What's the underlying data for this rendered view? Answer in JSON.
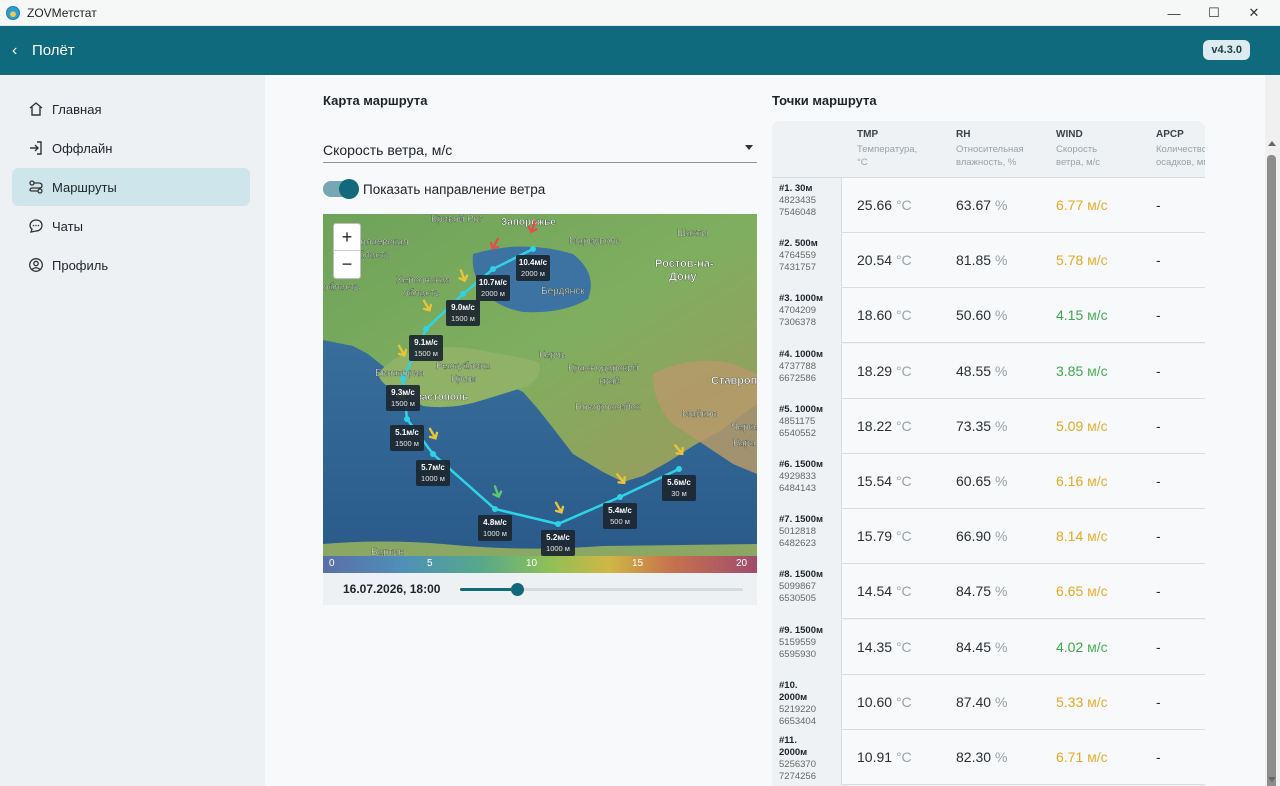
{
  "window": {
    "title": "ZOVМетстат",
    "minimize": "—",
    "maximize": "☐",
    "close": "✕"
  },
  "header": {
    "back_icon": "‹",
    "title": "Полёт",
    "version": "v4.3.0"
  },
  "sidebar": {
    "items": [
      {
        "label": "Главная",
        "icon": "home-icon",
        "active": false
      },
      {
        "label": "Оффлайн",
        "icon": "login-icon",
        "active": false
      },
      {
        "label": "Маршруты",
        "icon": "route-icon",
        "active": true
      },
      {
        "label": "Чаты",
        "icon": "chat-icon",
        "active": false
      },
      {
        "label": "Профиль",
        "icon": "profile-icon",
        "active": false
      }
    ]
  },
  "map_section": {
    "title": "Карта маршрута",
    "layer_select": "Скорость ветра, м/с",
    "toggle_label": "Показать направление ветра",
    "toggle_on": true,
    "zoom_in": "+",
    "zoom_out": "−",
    "scale_ticks": [
      "0",
      "5",
      "10",
      "15",
      "20"
    ],
    "datetime": "16.07.2026, 18:00",
    "slider_value": 0.2,
    "place_labels": [
      "Кривой Рог",
      "Запорожье",
      "Мариуполь",
      "Шахты",
      "Ростов-на-",
      "Дону",
      "Херсонская",
      "область",
      "Бердянск",
      "Республика",
      "Крым",
      "Керчь",
      "Краснодарский",
      "край",
      "Евпатория",
      "Севастополь",
      "Ставрополь",
      "Новороссийск",
      "Майкоп",
      "Черке",
      "Кара",
      "Бартин",
      "Николаевская",
      "область",
      "область"
    ],
    "waypoints": [
      {
        "speed": "10.4м/с",
        "alt": "2000 м"
      },
      {
        "speed": "10.7м/с",
        "alt": "2000 м"
      },
      {
        "speed": "9.0м/с",
        "alt": "1500 м"
      },
      {
        "speed": "9.1м/с",
        "alt": "1500 м"
      },
      {
        "speed": "9.3м/с",
        "alt": "1500 м"
      },
      {
        "speed": "5.1м/с",
        "alt": "1500 м"
      },
      {
        "speed": "5.7м/с",
        "alt": "1000 м"
      },
      {
        "speed": "4.8м/с",
        "alt": "1000 м"
      },
      {
        "speed": "5.2м/с",
        "alt": "1000 м"
      },
      {
        "speed": "5.4м/с",
        "alt": "500 м"
      },
      {
        "speed": "5.6м/с",
        "alt": "30 м"
      }
    ],
    "colors": {
      "route": "#2fd3e8",
      "yellow_arrow": "#e8c43a",
      "green_arrow": "#5cc86e",
      "red_arrow": "#e0504a"
    }
  },
  "table": {
    "title": "Точки маршрута",
    "columns": [
      {
        "code": "TMP",
        "desc1": "Температура,",
        "desc2": "°C"
      },
      {
        "code": "RH",
        "desc1": "Относительная",
        "desc2": "влажность, %"
      },
      {
        "code": "WIND",
        "desc1": "Скорость",
        "desc2": "ветра, м/с"
      },
      {
        "code": "APCP",
        "desc1": "Количество",
        "desc2": "осадков, мм"
      }
    ],
    "rows": [
      {
        "name": "#1. 30м",
        "c1": "4823435",
        "c2": "7546048",
        "tmp": "25.66",
        "rh": "63.67",
        "wind": "6.77",
        "apcp": "-",
        "wind_color": "#e8a81f"
      },
      {
        "name": "#2. 500м",
        "c1": "4764559",
        "c2": "7431757",
        "tmp": "20.54",
        "rh": "81.85",
        "wind": "5.78",
        "apcp": "-",
        "wind_color": "#e8a81f"
      },
      {
        "name": "#3. 1000м",
        "c1": "4704209",
        "c2": "7306378",
        "tmp": "18.60",
        "rh": "50.60",
        "wind": "4.15",
        "apcp": "-",
        "wind_color": "#3aa84a"
      },
      {
        "name": "#4. 1000м",
        "c1": "4737788",
        "c2": "6672586",
        "tmp": "18.29",
        "rh": "48.55",
        "wind": "3.85",
        "apcp": "-",
        "wind_color": "#3aa84a"
      },
      {
        "name": "#5. 1000м",
        "c1": "4851175",
        "c2": "6540552",
        "tmp": "18.22",
        "rh": "73.35",
        "wind": "5.09",
        "apcp": "-",
        "wind_color": "#e8a81f"
      },
      {
        "name": "#6. 1500м",
        "c1": "4929833",
        "c2": "6484143",
        "tmp": "15.54",
        "rh": "60.65",
        "wind": "6.16",
        "apcp": "-",
        "wind_color": "#e8a81f"
      },
      {
        "name": "#7. 1500м",
        "c1": "5012818",
        "c2": "6482623",
        "tmp": "15.79",
        "rh": "66.90",
        "wind": "8.14",
        "apcp": "-",
        "wind_color": "#e8a81f"
      },
      {
        "name": "#8. 1500м",
        "c1": "5099867",
        "c2": "6530505",
        "tmp": "14.54",
        "rh": "84.75",
        "wind": "6.65",
        "apcp": "-",
        "wind_color": "#e8a81f"
      },
      {
        "name": "#9. 1500м",
        "c1": "5159559",
        "c2": "6595930",
        "tmp": "14.35",
        "rh": "84.45",
        "wind": "4.02",
        "apcp": "-",
        "wind_color": "#3aa84a"
      },
      {
        "name": "#10.\n2000м",
        "c1": "5219220",
        "c2": "6653404",
        "tmp": "10.60",
        "rh": "87.40",
        "wind": "5.33",
        "apcp": "-",
        "wind_color": "#e8a81f"
      },
      {
        "name": "#11.\n2000м",
        "c1": "5256370",
        "c2": "7274256",
        "tmp": "10.91",
        "rh": "82.30",
        "wind": "6.71",
        "apcp": "-",
        "wind_color": "#e8a81f"
      }
    ],
    "units": {
      "tmp": "°C",
      "rh": "%",
      "wind": "м/с"
    }
  }
}
